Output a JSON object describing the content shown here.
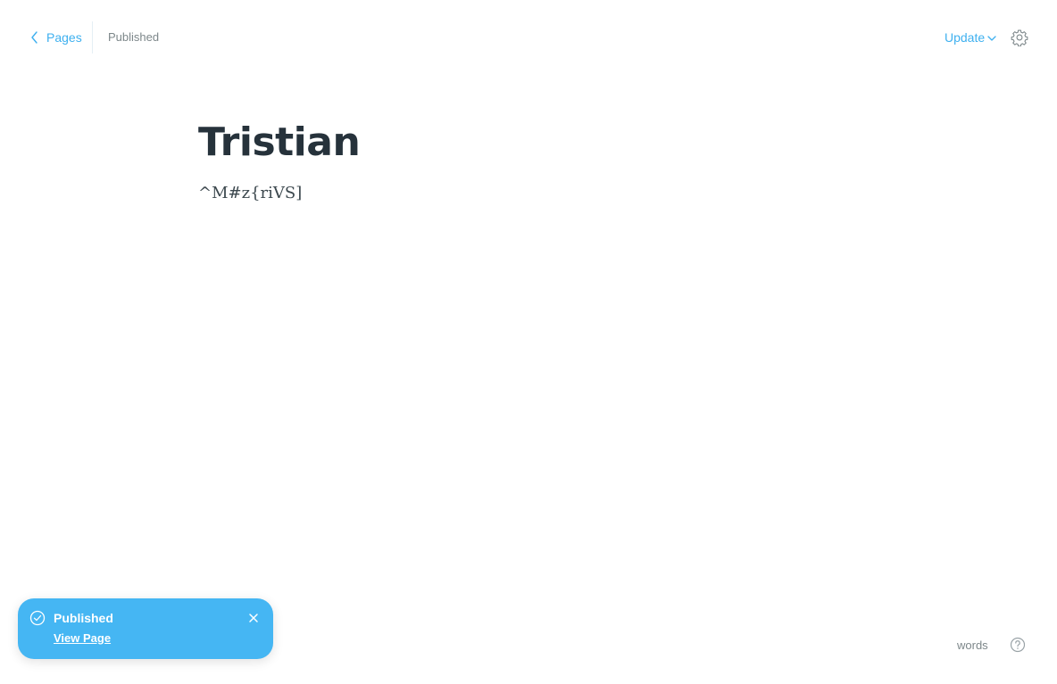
{
  "header": {
    "back_label": "Pages",
    "status": "Published",
    "update_label": "Update"
  },
  "post": {
    "title": "Tristian",
    "body": "^M#z{riVS]"
  },
  "toast": {
    "title": "Published",
    "link_label": "View Page"
  },
  "footer": {
    "word_count_label": "words"
  },
  "colors": {
    "accent": "#3eb0ef",
    "toast_bg": "#45b6f3",
    "muted": "#7d878a",
    "title": "#26323b"
  },
  "icons": {
    "back": "chevron-left-icon",
    "update": "chevron-down-icon",
    "settings": "gear-icon",
    "toast_status": "check-circle-icon",
    "toast_close": "close-icon",
    "help": "question-circle-icon"
  }
}
